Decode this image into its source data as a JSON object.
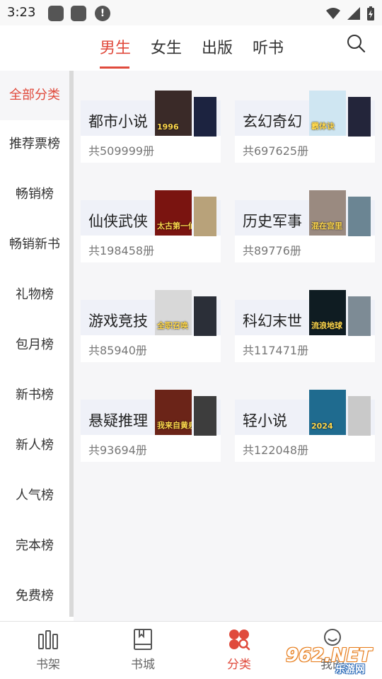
{
  "status_bar": {
    "time": "3:23",
    "notif_icons": [
      "app-icon",
      "app-icon",
      "alert-icon"
    ],
    "alert_glyph": "!"
  },
  "top_tabs": [
    {
      "label": "男生",
      "active": true
    },
    {
      "label": "女生",
      "active": false
    },
    {
      "label": "出版",
      "active": false
    },
    {
      "label": "听书",
      "active": false
    }
  ],
  "left_nav": [
    {
      "label": "全部分类",
      "active": true
    },
    {
      "label": "推荐票榜"
    },
    {
      "label": "畅销榜"
    },
    {
      "label": "畅销新书"
    },
    {
      "label": "礼物榜"
    },
    {
      "label": "包月榜"
    },
    {
      "label": "新书榜"
    },
    {
      "label": "新人榜"
    },
    {
      "label": "人气榜"
    },
    {
      "label": "完本榜"
    },
    {
      "label": "免费榜"
    }
  ],
  "categories": [
    {
      "title": "都市小说",
      "count": "共509999册",
      "cover_text": "1996",
      "colors": [
        "#3a2a28",
        "#1c2340"
      ]
    },
    {
      "title": "玄幻奇幻",
      "count": "共697625册",
      "cover_text": "霸体诀",
      "colors": [
        "#cfe6f2",
        "#23253a"
      ]
    },
    {
      "title": "仙侠武侠",
      "count": "共198458册",
      "cover_text": "太古第一仙",
      "colors": [
        "#7a1410",
        "#b8a27a"
      ]
    },
    {
      "title": "历史军事",
      "count": "共89776册",
      "cover_text": "混在宫里",
      "colors": [
        "#9a8a80",
        "#6b8593"
      ]
    },
    {
      "title": "游戏竞技",
      "count": "共85940册",
      "cover_text": "全职召唤",
      "colors": [
        "#d8d8d8",
        "#2b2f38"
      ]
    },
    {
      "title": "科幻末世",
      "count": "共117471册",
      "cover_text": "流浪地球",
      "colors": [
        "#0f1c22",
        "#7d8b95"
      ]
    },
    {
      "title": "悬疑推理",
      "count": "共93694册",
      "cover_text": "我来自黄泉",
      "colors": [
        "#6b2418",
        "#3d3d3d"
      ]
    },
    {
      "title": "轻小说",
      "count": "共122048册",
      "cover_text": "2024",
      "colors": [
        "#1f6b8f",
        "#c9c9c9"
      ]
    }
  ],
  "bottom_nav": [
    {
      "label": "书架",
      "icon": "bookshelf-icon",
      "active": false
    },
    {
      "label": "书城",
      "icon": "bookstore-icon",
      "active": false
    },
    {
      "label": "分类",
      "icon": "category-icon",
      "active": true
    },
    {
      "label": "我的",
      "icon": "profile-icon",
      "active": false
    }
  ],
  "watermark": {
    "logo": "962.NET",
    "sub": "乐游网"
  },
  "colors": {
    "accent": "#e04a3c",
    "panel_bg": "#f6f6f8",
    "card_top": "#eff1f8"
  }
}
